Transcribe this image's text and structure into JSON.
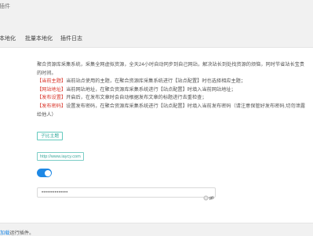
{
  "header": {
    "title": "插件"
  },
  "tabs": [
    {
      "label": "本地化"
    },
    {
      "label": "批量本地化"
    },
    {
      "label": "插件日志"
    }
  ],
  "description": {
    "intro_line1": "聚合资源库采集系统，采集全网虚拟资源，全天24小时自动同步到自己网站，解决站长到处找资源的烦恼，同时节省站长宝贵",
    "intro_line2": "的时间。",
    "items": [
      {
        "tag": "【当前主题】",
        "text": "当前站点使用的主题，在聚合资源库采集系统进行【站点配置】时也选择相应主题；"
      },
      {
        "tag": "【网站地址】",
        "text": "当前网站地址，在聚合资源库采集系统进行【站点配置】时填入当前网站地址；"
      },
      {
        "tag": "【发布设置】",
        "text": "开启后，在发布文章时会自动根据发布文章的标题进行去重检查；"
      },
      {
        "tag": "【发布密码】",
        "text": "设置发布密码，在聚合资源库采集系统进行【站点配置】时填入当前发布密码（请注意保管好发布密码,切勿泄露"
      },
      {
        "tag": "",
        "text": "给他人）"
      }
    ]
  },
  "theme_button": {
    "label": "子比主题"
  },
  "site_url": {
    "value": "http://www.iaycy.com"
  },
  "publish_toggle": {
    "state": "on",
    "color": "#1e88e5"
  },
  "password": {
    "masked_value": "••••••••••••••"
  },
  "footer": {
    "link_text": "加载",
    "suffix": "运行插件。"
  }
}
